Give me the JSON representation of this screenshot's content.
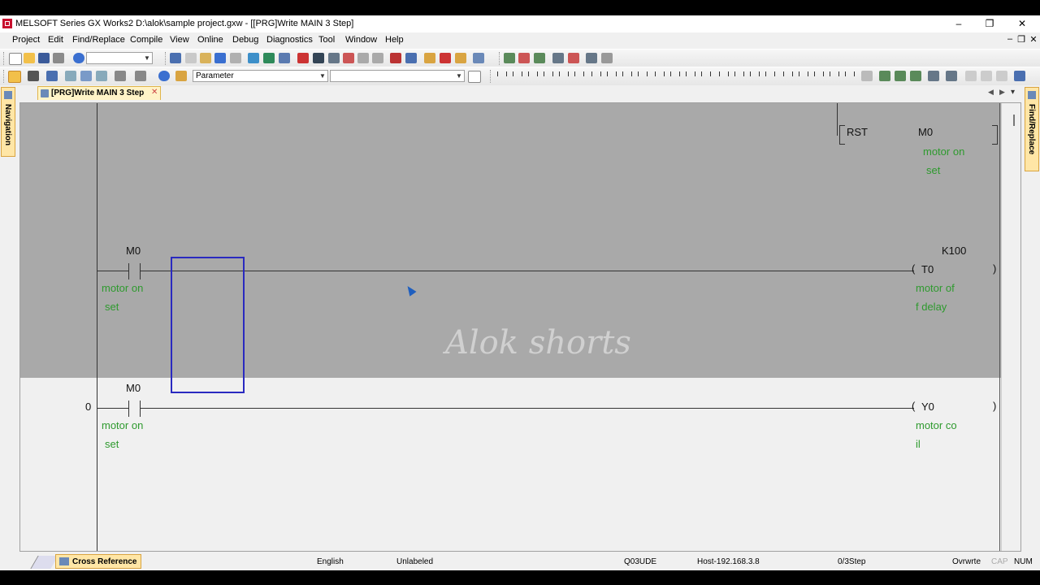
{
  "window": {
    "title": "MELSOFT Series GX Works2 D:\\alok\\sample project.gxw - [[PRG]Write MAIN 3 Step]",
    "minimize": "–",
    "restore": "❐",
    "close": "✕",
    "mdi_min": "–",
    "mdi_restore": "❐",
    "mdi_close": "✕"
  },
  "menu": [
    "Project",
    "Edit",
    "Find/Replace",
    "Compile",
    "View",
    "Online",
    "Debug",
    "Diagnostics",
    "Tool",
    "Window",
    "Help"
  ],
  "toolbar": {
    "parameter_combo": "Parameter"
  },
  "tabs": {
    "document_tab": "[PRG]Write MAIN 3 Step",
    "close": "✕",
    "nav_left": "◀",
    "nav_right": "▶",
    "nav_menu": "▾"
  },
  "side_tabs": {
    "left": "Navigation",
    "right": "Find/Replace"
  },
  "ladder": {
    "rst_instruction": "RST",
    "rst_device": "M0",
    "rst_comment_1": "motor on",
    "rst_comment_2": "set",
    "rung2_contact": "M0",
    "rung2_contact_comment_1": "motor on",
    "rung2_contact_comment_2": "set",
    "rung2_coil_const": "K100",
    "rung2_coil": "T0",
    "rung2_coil_comment_1": "motor of",
    "rung2_coil_comment_2": "f delay",
    "rung3_step": "0",
    "rung3_contact": "M0",
    "rung3_contact_comment_1": "motor on",
    "rung3_contact_comment_2": "set",
    "rung3_coil": "Y0",
    "rung3_coil_comment_1": "motor co",
    "rung3_coil_comment_2": "il",
    "watermark": "Alok shorts"
  },
  "bottom_tabs": {
    "cross_reference": "Cross Reference"
  },
  "status": {
    "language": "English",
    "label": "Unlabeled",
    "cpu": "Q03UDE",
    "host": "Host-192.168.3.8",
    "steps": "0/3Step",
    "mode": "Ovrwrte",
    "cap": "CAP",
    "num": "NUM"
  },
  "colors": {
    "comment_green": "#2e9a2e",
    "cursor_blue": "#2a2ac0",
    "grey_area": "#a9a9a9"
  }
}
